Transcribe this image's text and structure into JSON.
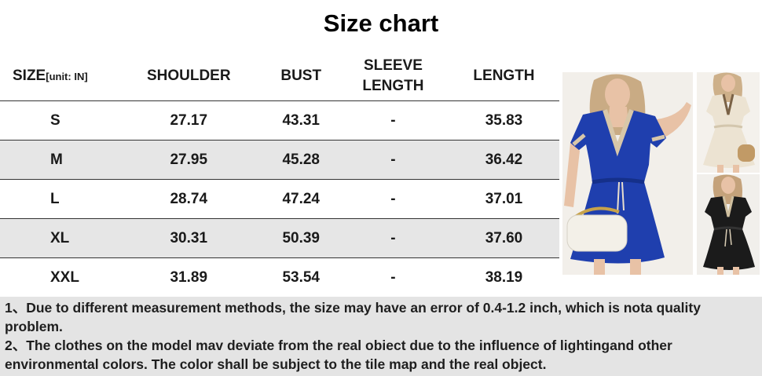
{
  "title": "Size chart",
  "table": {
    "headers": {
      "size": "SIZE",
      "unit": "[unit: IN]",
      "shoulder": "SHOULDER",
      "bust": "BUST",
      "sleeve_line1": "SLEEVE",
      "sleeve_line2": "LENGTH",
      "length": "LENGTH"
    },
    "rows": [
      {
        "size": "S",
        "shoulder": "27.17",
        "bust": "43.31",
        "sleeve": "-",
        "length": "35.83"
      },
      {
        "size": "M",
        "shoulder": "27.95",
        "bust": "45.28",
        "sleeve": "-",
        "length": "36.42"
      },
      {
        "size": "L",
        "shoulder": "28.74",
        "bust": "47.24",
        "sleeve": "-",
        "length": "37.01"
      },
      {
        "size": "XL",
        "shoulder": "30.31",
        "bust": "50.39",
        "sleeve": "-",
        "length": "37.60"
      },
      {
        "size": "XXL",
        "shoulder": "31.89",
        "bust": "53.54",
        "sleeve": "-",
        "length": "38.19"
      }
    ]
  },
  "notes": {
    "note1": "1、Due to different measurement methods, the size may have an error of 0.4-1.2 inch, which is nota quality problem.",
    "note2": "2、The clothes on the model mav deviate from the real obiect due to the influence of lightingand other environmental colors. The color shall be subject to the tile map and the real object."
  },
  "colors": {
    "blue_dress": "#1f3fae",
    "cream_dress": "#ece3d2",
    "black_dress": "#1b1b1b",
    "row_shade": "#e6e6e6",
    "notes_bg": "#e4e4e4"
  }
}
